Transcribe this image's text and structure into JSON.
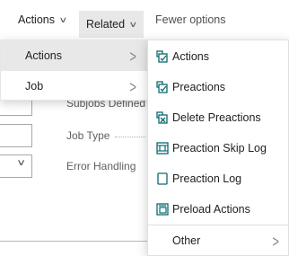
{
  "actionbar": {
    "actions_label": "Actions",
    "related_label": "Related",
    "fewer_label": "Fewer options"
  },
  "form": {
    "subjobs_label": "Subjobs Defined",
    "job_type_label": "Job Type",
    "error_handling_label": "Error Handling"
  },
  "menu": {
    "items": [
      {
        "label": "Actions"
      },
      {
        "label": "Job"
      }
    ]
  },
  "submenu": {
    "items": [
      {
        "label": "Actions",
        "icon": "actions-icon"
      },
      {
        "label": "Preactions",
        "icon": "preactions-icon"
      },
      {
        "label": "Delete Preactions",
        "icon": "delete-preactions-icon"
      },
      {
        "label": "Preaction Skip Log",
        "icon": "skip-log-icon"
      },
      {
        "label": "Preaction Log",
        "icon": "log-icon"
      },
      {
        "label": "Preload Actions",
        "icon": "preload-icon"
      },
      {
        "label": "Other",
        "icon": ""
      }
    ]
  },
  "colors": {
    "icon_blue": "#0b6a6f",
    "selected_bg": "#e8e8e8"
  }
}
